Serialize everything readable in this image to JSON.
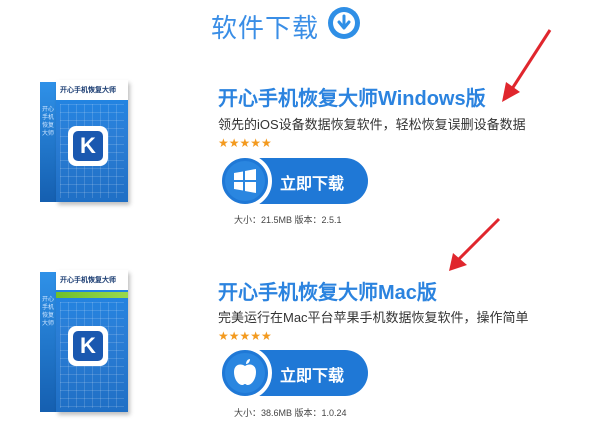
{
  "header": {
    "title": "软件下载",
    "icon": "download-circle-icon"
  },
  "products": [
    {
      "box_name": "开心手机恢复大师",
      "box_side_text": "开心手机恢复大师",
      "title": "开心手机恢复大师Windows版",
      "description": "领先的iOS设备数据恢复软件，轻松恢复误删设备数据",
      "rating": "★★★★★",
      "button_label": "立即下载",
      "button_icon": "windows-icon",
      "meta": "大小：21.5MB 版本：2.5.1"
    },
    {
      "box_name": "开心手机恢复大师",
      "box_side_text": "开心手机恢复大师",
      "title": "开心手机恢复大师Mac版",
      "description": "完美运行在Mac平台苹果手机数据恢复软件，操作简单",
      "rating": "★★★★★",
      "button_label": "立即下载",
      "button_icon": "apple-icon",
      "meta": "大小：38.6MB 版本：1.0.24"
    }
  ],
  "colors": {
    "accent": "#2b83df",
    "button": "#1f78d6",
    "star": "#f39a1f",
    "arrow": "#e0262d"
  }
}
